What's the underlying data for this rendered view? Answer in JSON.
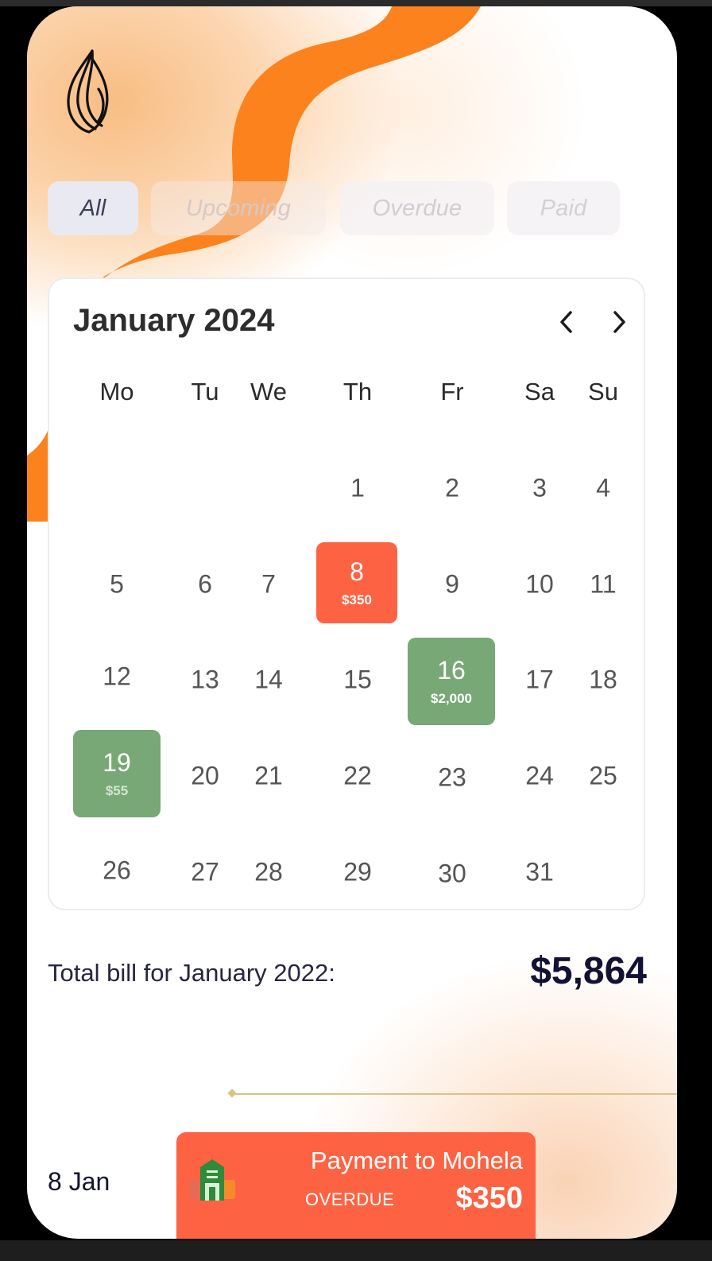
{
  "filters": {
    "all": "All",
    "upcoming": "Upcoming",
    "overdue": "Overdue",
    "paid": "Paid",
    "selected": "All"
  },
  "calendar": {
    "month_title": "January 2024",
    "weekdays": [
      "Mo",
      "Tu",
      "We",
      "Th",
      "Fr",
      "Sa",
      "Su"
    ],
    "days": [
      "1",
      "2",
      "3",
      "4",
      "5",
      "6",
      "7",
      "9",
      "10",
      "11",
      "12",
      "13",
      "14",
      "15",
      "17",
      "18",
      "20",
      "21",
      "22",
      "23",
      "24",
      "25",
      "26",
      "27",
      "28",
      "29",
      "30",
      "31"
    ],
    "bills": [
      {
        "day": "8",
        "amount": "$350",
        "status": "overdue"
      },
      {
        "day": "16",
        "amount": "$2,000",
        "status": "paid"
      },
      {
        "day": "19",
        "amount": "$55",
        "status": "paid"
      }
    ]
  },
  "summary": {
    "label": "Total bill for January 2022:",
    "total": "$5,864"
  },
  "timeline": {
    "date": "8 Jan",
    "payment": {
      "title": "Payment to Mohela",
      "status": "OVERDUE",
      "amount": "$350",
      "icon": "building-icon"
    }
  },
  "colors": {
    "accent_orange": "#fc821e",
    "overdue_red": "#fd6343",
    "paid_green": "#77a876",
    "navy": "#121235"
  }
}
